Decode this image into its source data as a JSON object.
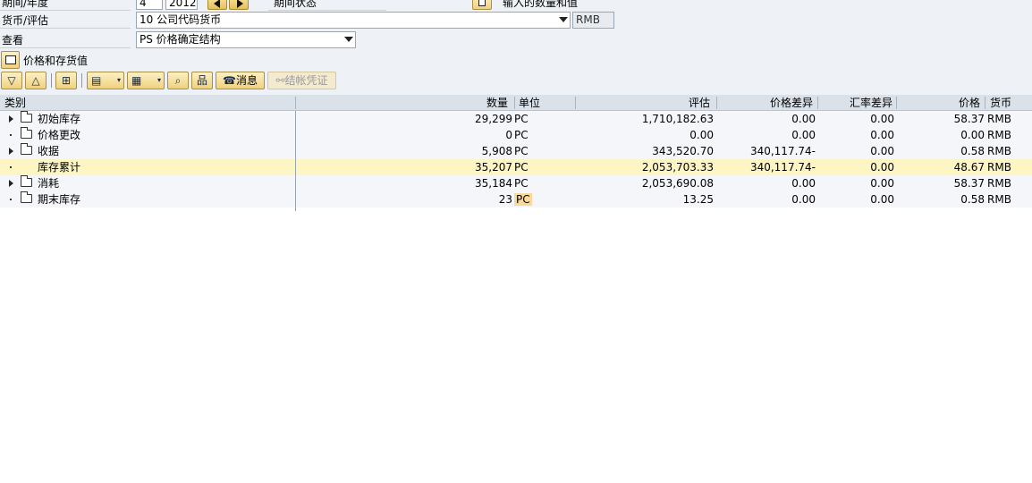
{
  "header": {
    "period_label": "期间/年度",
    "period_value": "4",
    "year_value": "2012",
    "period_status_label": "期间状态",
    "input_qty_label": "输入的数量和值",
    "currency_label": "货币/评估",
    "currency_value": "10 公司代码货币",
    "currency_code": "RMB",
    "view_label": "查看",
    "view_value": "PS 价格确定结构",
    "section_label": "价格和存货值"
  },
  "toolbar": {
    "message_label": "消息",
    "post_doc_label": "结帐凭证"
  },
  "grid": {
    "columns": {
      "category": "类别",
      "quantity": "数量",
      "unit": "单位",
      "valuation": "评估",
      "price_diff": "价格差异",
      "fx_diff": "汇率差异",
      "price": "价格",
      "currency": "货币"
    },
    "rows": [
      {
        "name": "初始库存",
        "qty": "29,299",
        "unit": "PC",
        "val": "1,710,182.63",
        "pdiff": "0.00",
        "fxdiff": "0.00",
        "price": "58.37",
        "cur": "RMB"
      },
      {
        "name": "价格更改",
        "qty": "0",
        "unit": "PC",
        "val": "0.00",
        "pdiff": "0.00",
        "fxdiff": "0.00",
        "price": "0.00",
        "cur": "RMB"
      },
      {
        "name": "收据",
        "qty": "5,908",
        "unit": "PC",
        "val": "343,520.70",
        "pdiff": "340,117.74-",
        "fxdiff": "0.00",
        "price": "0.58",
        "cur": "RMB"
      },
      {
        "name": "库存累计",
        "qty": "35,207",
        "unit": "PC",
        "val": "2,053,703.33",
        "pdiff": "340,117.74-",
        "fxdiff": "0.00",
        "price": "48.67",
        "cur": "RMB"
      },
      {
        "name": "消耗",
        "qty": "35,184",
        "unit": "PC",
        "val": "2,053,690.08",
        "pdiff": "0.00",
        "fxdiff": "0.00",
        "price": "58.37",
        "cur": "RMB"
      },
      {
        "name": "期末库存",
        "qty": "23",
        "unit": "PC",
        "val": "13.25",
        "pdiff": "0.00",
        "fxdiff": "0.00",
        "price": "0.58",
        "cur": "RMB"
      }
    ]
  },
  "colors": {
    "panel_bg": "#eef2f6",
    "header_bg": "#dbe1e8",
    "highlight_row": "#fdf6c4",
    "unit_highlight": "#f8d99a",
    "button_gold": "#efd27e"
  }
}
